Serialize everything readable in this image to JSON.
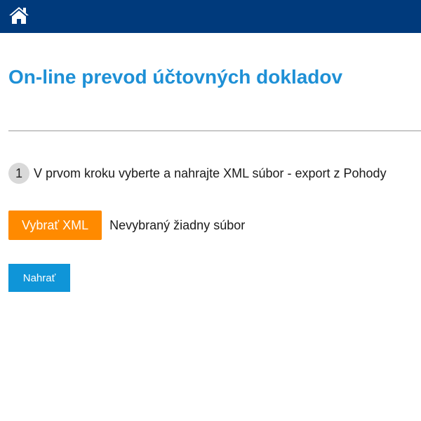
{
  "header": {
    "home_icon": "home-icon",
    "background_color": "#003a7c"
  },
  "page": {
    "title": "On-line prevod účtovných dokladov",
    "title_color": "#1e90d6"
  },
  "step": {
    "number": "1",
    "text": "V prvom kroku vyberte a nahrajte XML súbor - export z Pohody"
  },
  "file_input": {
    "button_label": "Vybrať XML",
    "status": "Nevybraný žiadny súbor",
    "button_color": "#ff8a00"
  },
  "upload": {
    "label": "Nahrať",
    "button_color": "#0f95d8"
  }
}
